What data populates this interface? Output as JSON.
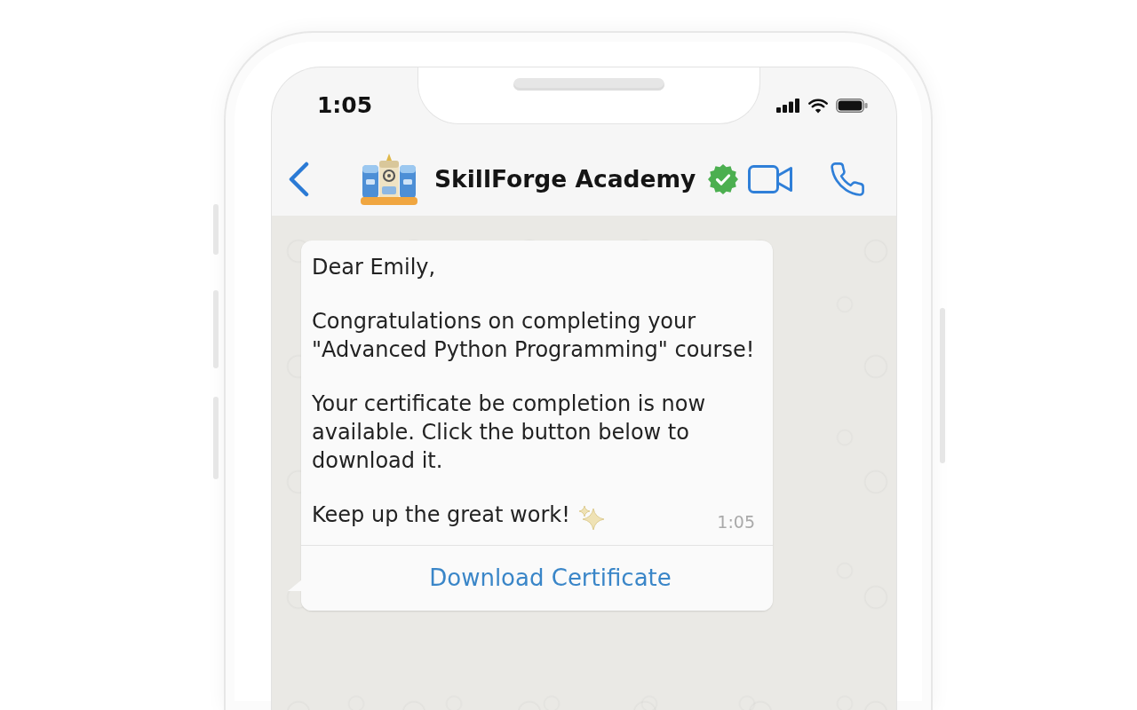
{
  "status_bar": {
    "time": "1:05"
  },
  "header": {
    "title": "SkillForge Academy",
    "verified": true
  },
  "message": {
    "paragraphs": [
      "Dear Emily,",
      "Congratulations on completing your \"Advanced Python Programming\" course!",
      "Your certificate be completion is now available. Click the button below to download it."
    ],
    "closing": "Keep up the great work!",
    "time": "1:05",
    "button": "Download Certificate"
  }
}
